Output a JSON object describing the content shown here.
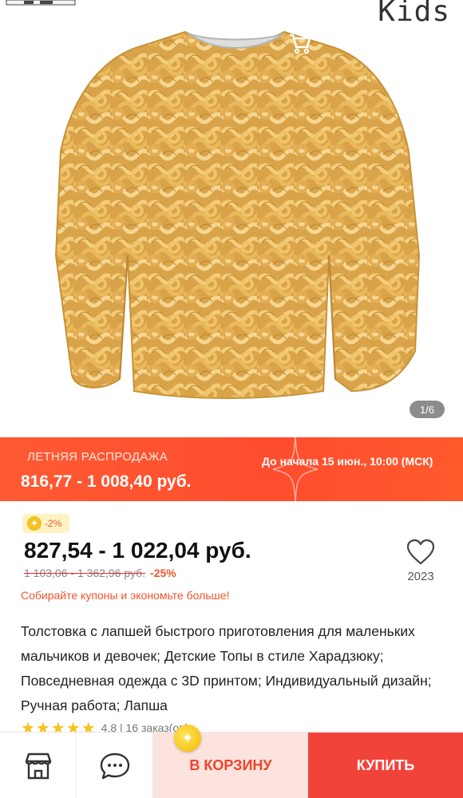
{
  "header": {
    "brand_text": "Kids",
    "back_icon": "arrow-left-icon",
    "cart_icon": "cart-icon",
    "share_icon": "share-icon",
    "more_icon": "more-vertical-icon"
  },
  "gallery": {
    "counter": "1/6"
  },
  "sale": {
    "title": "ЛЕТНЯЯ РАСПРОДАЖА",
    "price_range": "816,77 - 1 008,40 руб.",
    "start_info": "До начала 15 июн., 10:00 (МСК)"
  },
  "pricing": {
    "coupon_badge": "-2%",
    "price_range": "827,54 - 1 022,04 руб.",
    "old_price_range": "1 103,06 - 1 362,96 руб.",
    "discount": "-25%",
    "coupon_note": "Собирайте купоны и экономьте больше!"
  },
  "favorite": {
    "count": "2023"
  },
  "description": {
    "text": "Толстовка с лапшей быстрого приготовления для маленьких мальчиков и девочек; Детские Топы в стиле Харадзюку; Повседневная одежда с 3D принтом; Индивидуальный дизайн; Ручная работа; Лапша"
  },
  "rating": {
    "stars": "★★★★★",
    "text": "4.8 | 16 заказ(ов)"
  },
  "bottom_bar": {
    "add_to_cart": "В КОРЗИНУ",
    "buy": "КУПИТЬ"
  },
  "colors": {
    "accent": "#f2433b",
    "sale_banner": "#ff5a33",
    "cart_button_bg": "#fde3dd",
    "star": "#f7c21a"
  }
}
